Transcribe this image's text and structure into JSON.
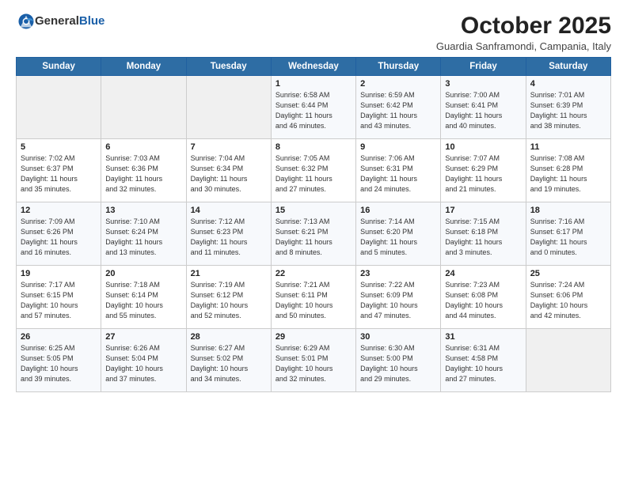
{
  "header": {
    "logo_general": "General",
    "logo_blue": "Blue",
    "month": "October 2025",
    "location": "Guardia Sanframondi, Campania, Italy"
  },
  "weekdays": [
    "Sunday",
    "Monday",
    "Tuesday",
    "Wednesday",
    "Thursday",
    "Friday",
    "Saturday"
  ],
  "rows": [
    [
      {
        "day": "",
        "text": ""
      },
      {
        "day": "",
        "text": ""
      },
      {
        "day": "",
        "text": ""
      },
      {
        "day": "1",
        "text": "Sunrise: 6:58 AM\nSunset: 6:44 PM\nDaylight: 11 hours\nand 46 minutes."
      },
      {
        "day": "2",
        "text": "Sunrise: 6:59 AM\nSunset: 6:42 PM\nDaylight: 11 hours\nand 43 minutes."
      },
      {
        "day": "3",
        "text": "Sunrise: 7:00 AM\nSunset: 6:41 PM\nDaylight: 11 hours\nand 40 minutes."
      },
      {
        "day": "4",
        "text": "Sunrise: 7:01 AM\nSunset: 6:39 PM\nDaylight: 11 hours\nand 38 minutes."
      }
    ],
    [
      {
        "day": "5",
        "text": "Sunrise: 7:02 AM\nSunset: 6:37 PM\nDaylight: 11 hours\nand 35 minutes."
      },
      {
        "day": "6",
        "text": "Sunrise: 7:03 AM\nSunset: 6:36 PM\nDaylight: 11 hours\nand 32 minutes."
      },
      {
        "day": "7",
        "text": "Sunrise: 7:04 AM\nSunset: 6:34 PM\nDaylight: 11 hours\nand 30 minutes."
      },
      {
        "day": "8",
        "text": "Sunrise: 7:05 AM\nSunset: 6:32 PM\nDaylight: 11 hours\nand 27 minutes."
      },
      {
        "day": "9",
        "text": "Sunrise: 7:06 AM\nSunset: 6:31 PM\nDaylight: 11 hours\nand 24 minutes."
      },
      {
        "day": "10",
        "text": "Sunrise: 7:07 AM\nSunset: 6:29 PM\nDaylight: 11 hours\nand 21 minutes."
      },
      {
        "day": "11",
        "text": "Sunrise: 7:08 AM\nSunset: 6:28 PM\nDaylight: 11 hours\nand 19 minutes."
      }
    ],
    [
      {
        "day": "12",
        "text": "Sunrise: 7:09 AM\nSunset: 6:26 PM\nDaylight: 11 hours\nand 16 minutes."
      },
      {
        "day": "13",
        "text": "Sunrise: 7:10 AM\nSunset: 6:24 PM\nDaylight: 11 hours\nand 13 minutes."
      },
      {
        "day": "14",
        "text": "Sunrise: 7:12 AM\nSunset: 6:23 PM\nDaylight: 11 hours\nand 11 minutes."
      },
      {
        "day": "15",
        "text": "Sunrise: 7:13 AM\nSunset: 6:21 PM\nDaylight: 11 hours\nand 8 minutes."
      },
      {
        "day": "16",
        "text": "Sunrise: 7:14 AM\nSunset: 6:20 PM\nDaylight: 11 hours\nand 5 minutes."
      },
      {
        "day": "17",
        "text": "Sunrise: 7:15 AM\nSunset: 6:18 PM\nDaylight: 11 hours\nand 3 minutes."
      },
      {
        "day": "18",
        "text": "Sunrise: 7:16 AM\nSunset: 6:17 PM\nDaylight: 11 hours\nand 0 minutes."
      }
    ],
    [
      {
        "day": "19",
        "text": "Sunrise: 7:17 AM\nSunset: 6:15 PM\nDaylight: 10 hours\nand 57 minutes."
      },
      {
        "day": "20",
        "text": "Sunrise: 7:18 AM\nSunset: 6:14 PM\nDaylight: 10 hours\nand 55 minutes."
      },
      {
        "day": "21",
        "text": "Sunrise: 7:19 AM\nSunset: 6:12 PM\nDaylight: 10 hours\nand 52 minutes."
      },
      {
        "day": "22",
        "text": "Sunrise: 7:21 AM\nSunset: 6:11 PM\nDaylight: 10 hours\nand 50 minutes."
      },
      {
        "day": "23",
        "text": "Sunrise: 7:22 AM\nSunset: 6:09 PM\nDaylight: 10 hours\nand 47 minutes."
      },
      {
        "day": "24",
        "text": "Sunrise: 7:23 AM\nSunset: 6:08 PM\nDaylight: 10 hours\nand 44 minutes."
      },
      {
        "day": "25",
        "text": "Sunrise: 7:24 AM\nSunset: 6:06 PM\nDaylight: 10 hours\nand 42 minutes."
      }
    ],
    [
      {
        "day": "26",
        "text": "Sunrise: 6:25 AM\nSunset: 5:05 PM\nDaylight: 10 hours\nand 39 minutes."
      },
      {
        "day": "27",
        "text": "Sunrise: 6:26 AM\nSunset: 5:04 PM\nDaylight: 10 hours\nand 37 minutes."
      },
      {
        "day": "28",
        "text": "Sunrise: 6:27 AM\nSunset: 5:02 PM\nDaylight: 10 hours\nand 34 minutes."
      },
      {
        "day": "29",
        "text": "Sunrise: 6:29 AM\nSunset: 5:01 PM\nDaylight: 10 hours\nand 32 minutes."
      },
      {
        "day": "30",
        "text": "Sunrise: 6:30 AM\nSunset: 5:00 PM\nDaylight: 10 hours\nand 29 minutes."
      },
      {
        "day": "31",
        "text": "Sunrise: 6:31 AM\nSunset: 4:58 PM\nDaylight: 10 hours\nand 27 minutes."
      },
      {
        "day": "",
        "text": ""
      }
    ]
  ]
}
